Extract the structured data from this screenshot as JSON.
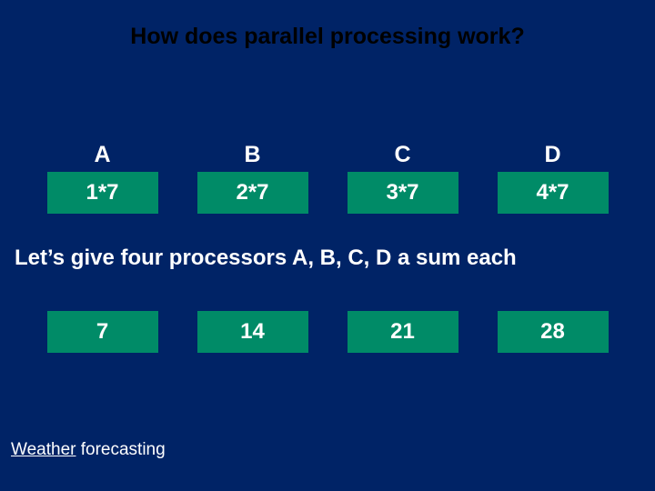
{
  "title": "How does parallel processing work?",
  "processors": {
    "labels": [
      "A",
      "B",
      "C",
      "D"
    ],
    "expr": [
      "1*7",
      "2*7",
      "3*7",
      "4*7"
    ]
  },
  "caption": "Let’s give four processors A, B, C, D a sum each",
  "results": [
    "7",
    "14",
    "21",
    "28"
  ],
  "footer": {
    "underlined": "Weather",
    "rest": " forecasting"
  }
}
